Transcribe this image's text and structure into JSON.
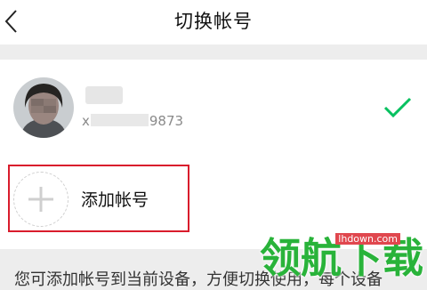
{
  "header": {
    "title": "切换帐号"
  },
  "account": {
    "id_prefix": "x",
    "id_suffix": "9873"
  },
  "add_account": {
    "label": "添加帐号"
  },
  "footer": {
    "note": "您可添加帐号到当前设备，方便切换使用，每个设备"
  },
  "watermark": {
    "site": "lhdown.com",
    "title": "领航下载"
  },
  "colors": {
    "accent": "#07c160",
    "highlight_border": "#d91c2c",
    "background": "#ededed"
  }
}
